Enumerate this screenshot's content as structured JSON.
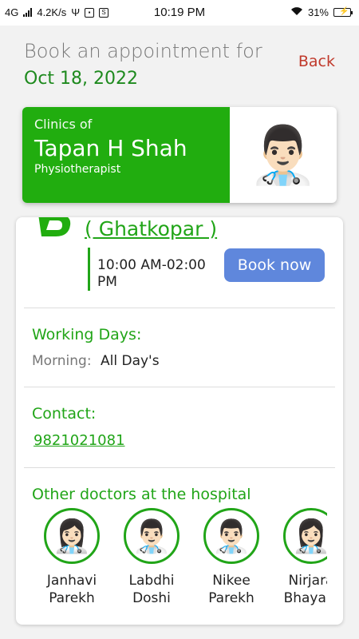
{
  "status_bar": {
    "network": "4G",
    "speed": "4.2K/s",
    "time": "10:19 PM",
    "battery": "31%"
  },
  "header": {
    "title": "Book an appointment for",
    "date": "Oct 18, 2022",
    "back_label": "Back"
  },
  "doctor": {
    "clinics_label": "Clinics of",
    "name": "Tapan H Shah",
    "specialty": "Physiotherapist",
    "photo": "👨🏻‍⚕️"
  },
  "clinic": {
    "name": "( Ghatkopar )",
    "timing": "10:00 AM-02:00 PM",
    "book_label": "Book now",
    "logo_color": "#21ad0f"
  },
  "working_days": {
    "title": "Working Days:",
    "label": "Morning:",
    "value": "All Day's"
  },
  "contact": {
    "title": "Contact:",
    "phone": "9821021081"
  },
  "other_doctors": {
    "title": "Other doctors at the hospital",
    "items": [
      {
        "name_line1": "Janhavi",
        "name_line2": "Parekh",
        "avatar": "👩🏻‍⚕️"
      },
      {
        "name_line1": "Labdhi",
        "name_line2": "Doshi",
        "avatar": "👨🏻‍⚕️"
      },
      {
        "name_line1": "Nikee",
        "name_line2": "Parekh",
        "avatar": "👨🏻‍⚕️"
      },
      {
        "name_line1": "Nirjara",
        "name_line2": "Bhayani",
        "avatar": "👩🏻‍⚕️"
      }
    ]
  },
  "colors": {
    "brand_green": "#21ad0f",
    "book_blue": "#5f87dc",
    "back_red": "#c0392b"
  }
}
